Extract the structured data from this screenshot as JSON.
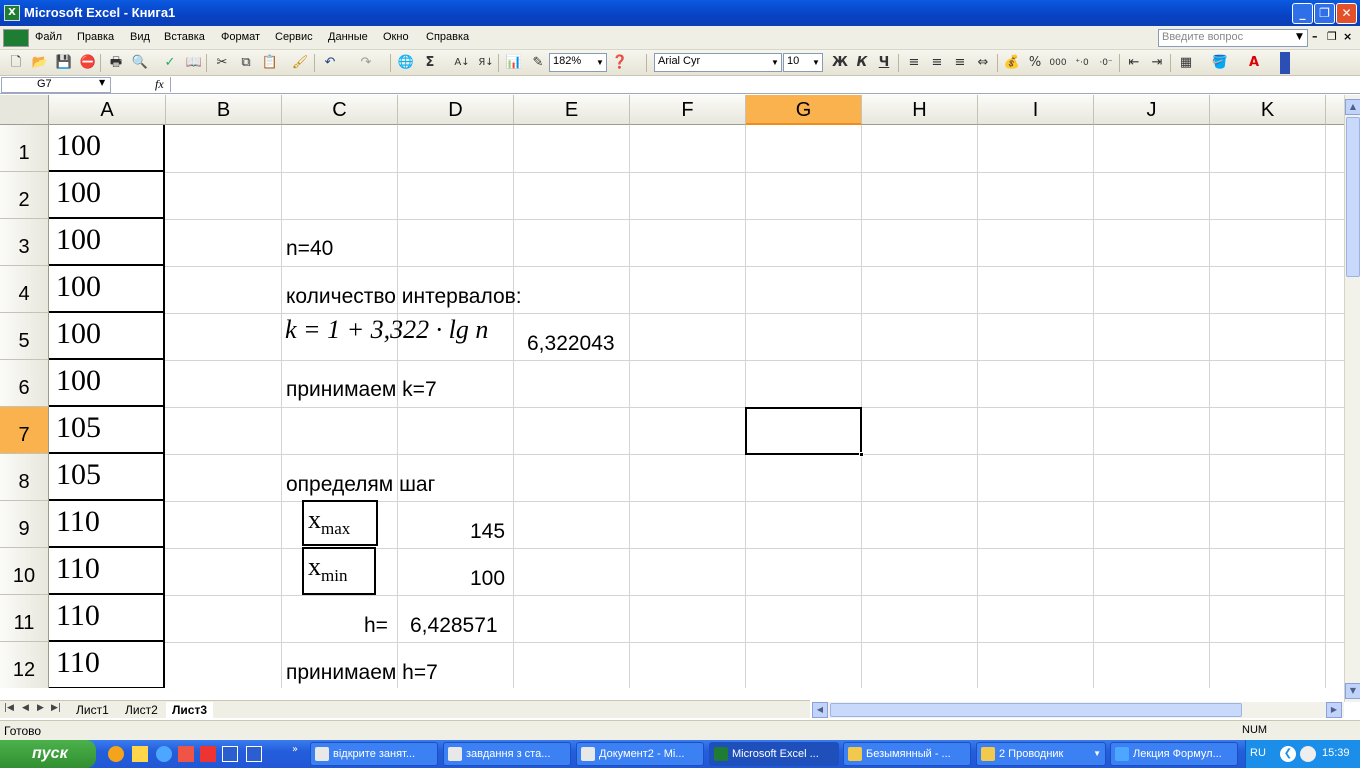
{
  "window": {
    "title": "Microsoft Excel - Книга1",
    "min": "_",
    "restore": "❐",
    "close": "✕"
  },
  "menu": [
    "Файл",
    "Правка",
    "Вид",
    "Вставка",
    "Формат",
    "Сервис",
    "Данные",
    "Окно",
    "Справка"
  ],
  "help_box": {
    "placeholder": "Введите вопрос"
  },
  "toolbar": {
    "zoom": "182%",
    "font": "Arial Cyr",
    "size": "10",
    "bold": "Ж",
    "italic": "К",
    "underline": "Ч",
    "percent": "%",
    "thousands": "000"
  },
  "formula_bar": {
    "name_box": "G7",
    "fx": "fx",
    "content": ""
  },
  "columns": [
    "A",
    "B",
    "C",
    "D",
    "E",
    "F",
    "G",
    "H",
    "I",
    "J",
    "K"
  ],
  "selected_column": "G",
  "rows": [
    "1",
    "2",
    "3",
    "4",
    "5",
    "6",
    "7",
    "8",
    "9",
    "10",
    "11",
    "12"
  ],
  "selected_row": "7",
  "col_a_values": [
    "100",
    "100",
    "100",
    "100",
    "100",
    "100",
    "105",
    "105",
    "110",
    "110",
    "110",
    "110"
  ],
  "cells": {
    "c3": "n=40",
    "c4": "количество интервалов:",
    "c5_formula": "k = 1 + 3,322 · lg n",
    "e5": "6,322043",
    "c6": "принимаем k=7",
    "c8": "определям шаг",
    "x_sym": "x",
    "max_sub": "max",
    "min_sub": "min",
    "d9": "145",
    "d10": "100",
    "c11": "h=",
    "d11": "6,428571",
    "c12": "принимаем h=7"
  },
  "sheets": [
    "Лист1",
    "Лист2",
    "Лист3"
  ],
  "active_sheet": "Лист3",
  "status": {
    "ready": "Готово",
    "num": "NUM"
  },
  "taskbar": {
    "start": "пуск",
    "tasks": [
      "відкрите занят...",
      "завдання з ста...",
      "Документ2 - Mi...",
      "Microsoft Excel ...",
      "Безымянный - ...",
      "2 Проводник",
      "Лекция Формул..."
    ],
    "active_task": 3,
    "lang": "RU",
    "time": "15:39"
  }
}
